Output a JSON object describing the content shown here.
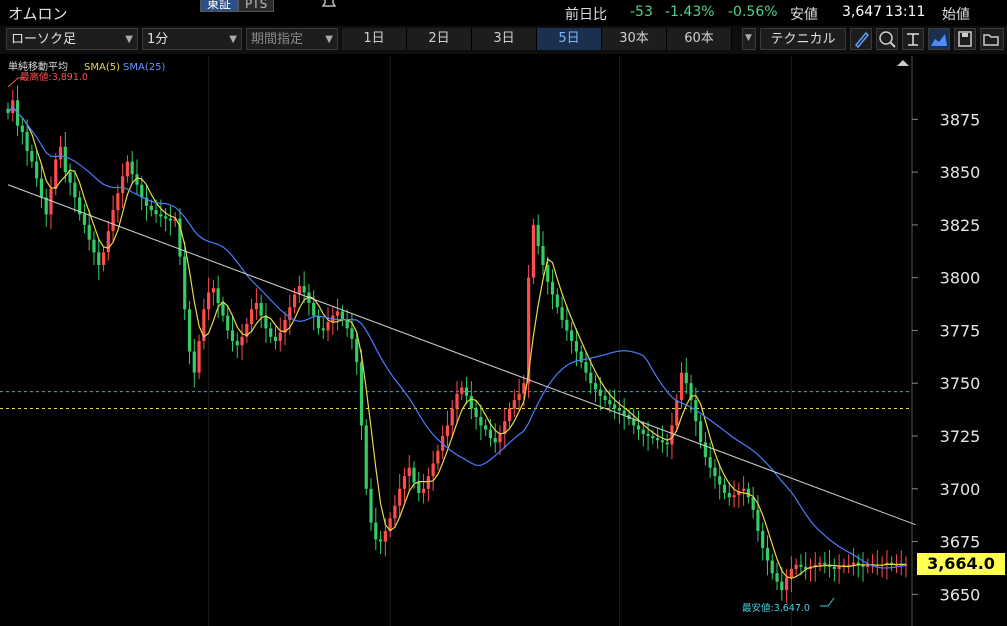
{
  "header": {
    "title": "オムロン",
    "exchange_tabs": [
      "東証",
      "PTS"
    ],
    "prev_close_label": "前日比",
    "change": "-53",
    "change_pct": "-1.43%",
    "change_pct2": "-0.56%",
    "low_label": "安値",
    "low_value": "3,647",
    "time": "13:11",
    "open_label": "始値"
  },
  "toolbar": {
    "chart_type": "ローソク足",
    "interval": "1分",
    "period": "期間指定",
    "ranges": [
      "1日",
      "2日",
      "3日",
      "5日",
      "30本",
      "60本"
    ],
    "active_range": "5日",
    "technical_label": "テクニカル"
  },
  "colors": {
    "up": "#ff4d4d",
    "down": "#33cc66",
    "sma5": "#e8d84a",
    "sma25": "#4a7dff",
    "accent": "#ffff50",
    "cyan_line": "#3ab0c0",
    "yellow_line": "#e8d84a"
  },
  "chart_data": {
    "type": "candlestick",
    "legend": {
      "label": "単純移動平均",
      "series": [
        "SMA(5)",
        "SMA(25)"
      ]
    },
    "yticks": [
      3650,
      3675,
      3700,
      3725,
      3750,
      3775,
      3800,
      3825,
      3850,
      3875
    ],
    "ylim": [
      3635,
      3905
    ],
    "current_price_label": "3,664.0",
    "current_price": 3664,
    "high_annotation": "最高値:3,891.0",
    "high": 3891,
    "low_annotation": "最安値:3,647.0",
    "low": 3647,
    "ref_lines": [
      {
        "name": "cyan-dashed",
        "value": 3746
      },
      {
        "name": "yellow-dashed",
        "value": 3738
      }
    ],
    "trendline": {
      "from": {
        "index": 0,
        "value": 3844
      },
      "to": {
        "index": 190,
        "value": 3683
      }
    },
    "day_separators": [
      42,
      80,
      128,
      164
    ],
    "series": [
      3878,
      3884,
      3872,
      3869,
      3860,
      3855,
      3847,
      3838,
      3830,
      3842,
      3856,
      3862,
      3850,
      3845,
      3838,
      3830,
      3825,
      3818,
      3812,
      3806,
      3812,
      3822,
      3832,
      3840,
      3848,
      3855,
      3849,
      3844,
      3838,
      3834,
      3832,
      3830,
      3829,
      3828,
      3827,
      3828,
      3810,
      3785,
      3765,
      3755,
      3770,
      3785,
      3793,
      3795,
      3788,
      3782,
      3775,
      3770,
      3768,
      3772,
      3778,
      3785,
      3788,
      3782,
      3776,
      3772,
      3770,
      3774,
      3780,
      3786,
      3792,
      3796,
      3793,
      3788,
      3782,
      3776,
      3775,
      3779,
      3782,
      3784,
      3780,
      3776,
      3771,
      3760,
      3730,
      3700,
      3684,
      3676,
      3675,
      3680,
      3686,
      3692,
      3700,
      3706,
      3710,
      3703,
      3698,
      3700,
      3706,
      3712,
      3718,
      3725,
      3730,
      3738,
      3745,
      3748,
      3744,
      3738,
      3734,
      3730,
      3728,
      3724,
      3722,
      3726,
      3732,
      3738,
      3742,
      3745,
      3750,
      3800,
      3825,
      3815,
      3806,
      3798,
      3792,
      3786,
      3780,
      3775,
      3770,
      3765,
      3760,
      3755,
      3750,
      3747,
      3744,
      3742,
      3740,
      3738,
      3737,
      3735,
      3733,
      3730,
      3728,
      3726,
      3725,
      3724,
      3723,
      3722,
      3721,
      3730,
      3742,
      3755,
      3750,
      3742,
      3732,
      3722,
      3715,
      3710,
      3706,
      3702,
      3698,
      3696,
      3697,
      3699,
      3700,
      3696,
      3690,
      3680,
      3672,
      3666,
      3660,
      3656,
      3652,
      3658,
      3662,
      3664,
      3663,
      3662,
      3663,
      3664,
      3665,
      3664,
      3663,
      3662,
      3663,
      3664,
      3664,
      3665,
      3664,
      3663,
      3664,
      3664,
      3664,
      3664,
      3665,
      3664,
      3664,
      3664,
      3664
    ]
  }
}
